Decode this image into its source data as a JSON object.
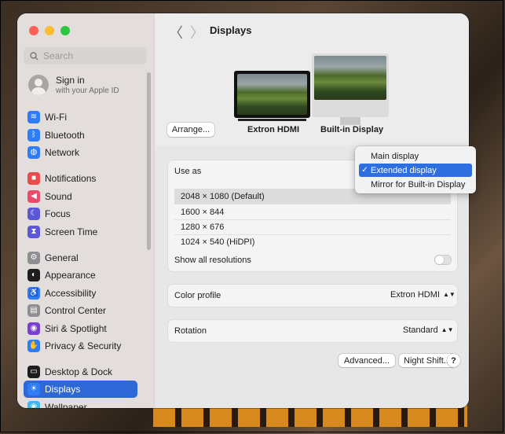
{
  "sidebar": {
    "search_placeholder": "Search",
    "signin": {
      "title": "Sign in",
      "subtitle": "with your Apple ID"
    },
    "items": [
      {
        "label": "Wi-Fi",
        "icon": "wifi-icon",
        "color": "#2e7cf6",
        "glyph": "≋"
      },
      {
        "label": "Bluetooth",
        "icon": "bluetooth-icon",
        "color": "#2e7cf6",
        "glyph": "ᛒ"
      },
      {
        "label": "Network",
        "icon": "globe-icon",
        "color": "#2e7cf6",
        "glyph": "◍"
      },
      {
        "label": "Notifications",
        "icon": "bell-icon",
        "color": "#ea4b4b",
        "glyph": "■"
      },
      {
        "label": "Sound",
        "icon": "speaker-icon",
        "color": "#ea4b6b",
        "glyph": "◀"
      },
      {
        "label": "Focus",
        "icon": "moon-icon",
        "color": "#5b57d6",
        "glyph": "☾"
      },
      {
        "label": "Screen Time",
        "icon": "hourglass-icon",
        "color": "#5b57d6",
        "glyph": "⧗"
      },
      {
        "label": "General",
        "icon": "gear-icon",
        "color": "#8e8e93",
        "glyph": "⚙"
      },
      {
        "label": "Appearance",
        "icon": "appearance-icon",
        "color": "#1d1d1f",
        "glyph": "◐"
      },
      {
        "label": "Accessibility",
        "icon": "accessibility-icon",
        "color": "#2e7cf6",
        "glyph": "♿"
      },
      {
        "label": "Control Center",
        "icon": "control-center-icon",
        "color": "#8e8e93",
        "glyph": "▤"
      },
      {
        "label": "Siri & Spotlight",
        "icon": "siri-icon",
        "color": "#7a3fcf",
        "glyph": "◉"
      },
      {
        "label": "Privacy & Security",
        "icon": "hand-icon",
        "color": "#2e7cf6",
        "glyph": "✋"
      },
      {
        "label": "Desktop & Dock",
        "icon": "dock-icon",
        "color": "#1d1d1f",
        "glyph": "▭"
      },
      {
        "label": "Displays",
        "icon": "sun-icon",
        "color": "#2e7cf6",
        "glyph": "☀",
        "active": true
      },
      {
        "label": "Wallpaper",
        "icon": "wallpaper-icon",
        "color": "#3db8e8",
        "glyph": "❀"
      }
    ]
  },
  "main": {
    "title": "Displays",
    "arrange_label": "Arrange...",
    "displays": [
      {
        "label": "Extron HDMI"
      },
      {
        "label": "Built-in Display"
      }
    ],
    "use_as_label": "Use as",
    "resolutions": [
      {
        "label": "2048 × 1080 (Default)",
        "selected": true
      },
      {
        "label": "1600 × 844"
      },
      {
        "label": "1280 × 676"
      },
      {
        "label": "1024 × 540 (HiDPI)"
      }
    ],
    "show_all_label": "Show all resolutions",
    "color_profile_label": "Color profile",
    "color_profile_value": "Extron HDMI",
    "rotation_label": "Rotation",
    "rotation_value": "Standard",
    "advanced_label": "Advanced...",
    "night_shift_label": "Night Shift...",
    "help_label": "?"
  },
  "use_as_menu": {
    "items": [
      {
        "label": "Main display"
      },
      {
        "label": "Extended display",
        "checked": true
      },
      {
        "label": "Mirror for Built-in Display"
      }
    ]
  }
}
